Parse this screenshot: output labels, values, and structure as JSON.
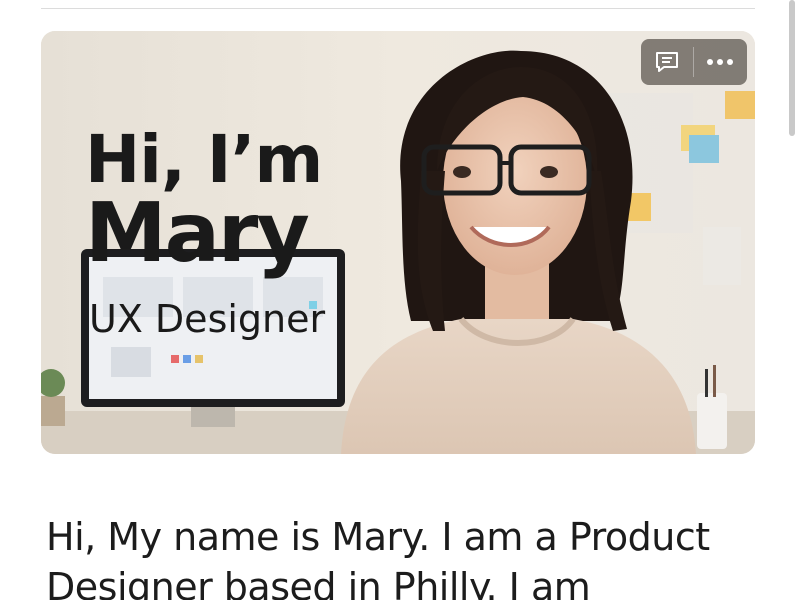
{
  "hero": {
    "greeting": "Hi, I’m",
    "name": "Mary",
    "role": "UX Designer",
    "image_alt": "Portrait of Mary smiling with glasses in an office",
    "actions": {
      "comment_icon": "comment-icon",
      "more_icon": "more-horizontal-icon"
    }
  },
  "intro": {
    "text": "Hi, My name is Mary. I am a Product Designer based in Philly. I am"
  },
  "colors": {
    "text": "#1c1c1c",
    "action_bg": "#6e6862",
    "divider": "#dcdcdc"
  }
}
